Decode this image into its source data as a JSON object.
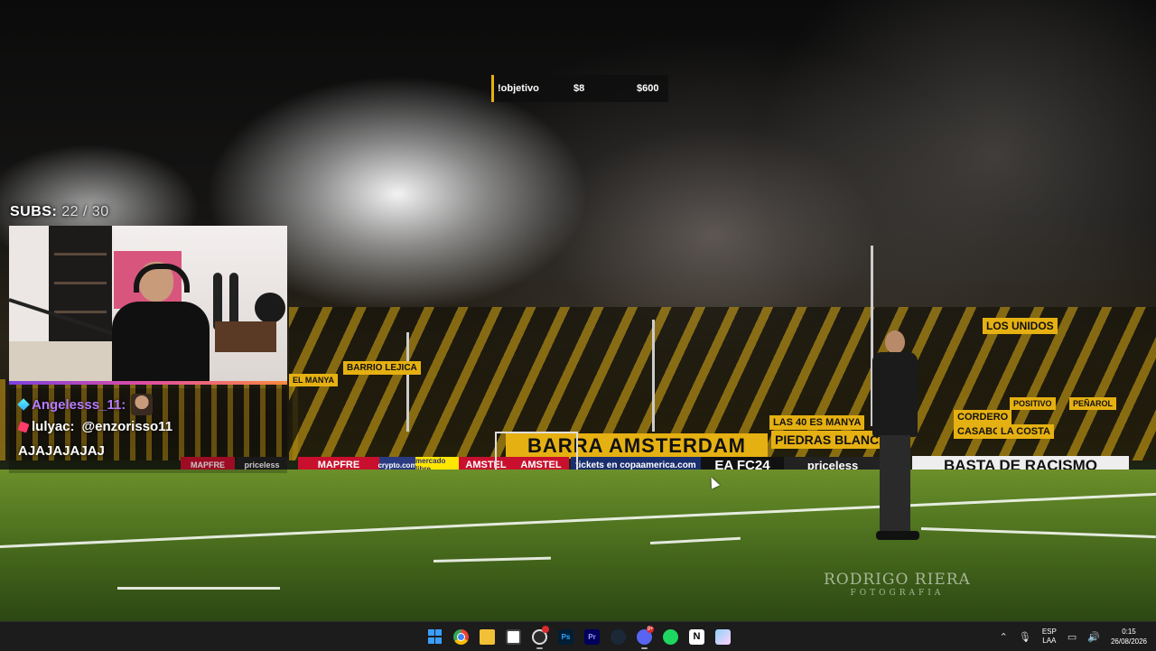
{
  "overlay": {
    "goal": {
      "label": "!objetivo",
      "current": "$8",
      "target": "$600"
    },
    "subs": {
      "label": "SUBS:",
      "count": "22 / 30"
    },
    "chat": [
      {
        "user": "Angelesss_11:",
        "message": ""
      },
      {
        "user": "lulyac:",
        "message": "@enzorisso11"
      },
      {
        "user": "",
        "message": "AJAJAJAJAJ"
      }
    ]
  },
  "wallpaper": {
    "banner": "BARRA AMSTERDAM",
    "ads": [
      "AMSTEL",
      "AMSTEL",
      "tickets en copaamerica.com",
      "EA FC24",
      "priceless",
      "BASTA DE RACISMO",
      "MAPFRE",
      "MAPFRE",
      "priceless",
      "crypto.com",
      "mercado libre"
    ],
    "signs": [
      "LAS 40 ES MANYA",
      "PIEDRAS BLANCAS",
      "CORDERO",
      "CASABO",
      "LA COSTA",
      "PEÑAROL",
      "BARRIO",
      "POSITIVO",
      "LOS UNIDOS",
      "BARRIO LEJICA",
      "EL MANYA"
    ],
    "watermark": {
      "name": "RODRIGO RIERA",
      "sub": "FOTOGRAFIA"
    }
  },
  "taskbar": {
    "apps": [
      {
        "name": "start",
        "label": ""
      },
      {
        "name": "chrome",
        "label": ""
      },
      {
        "name": "file-explorer",
        "label": ""
      },
      {
        "name": "snipping-tool",
        "label": ""
      },
      {
        "name": "obs",
        "label": ""
      },
      {
        "name": "photoshop",
        "label": "Ps"
      },
      {
        "name": "premiere",
        "label": "Pr"
      },
      {
        "name": "steam",
        "label": ""
      },
      {
        "name": "discord",
        "label": ""
      },
      {
        "name": "spotify",
        "label": ""
      },
      {
        "name": "notion",
        "label": "N"
      },
      {
        "name": "photos",
        "label": ""
      }
    ],
    "discord_badge": "9+",
    "language": {
      "line1": "ESP",
      "line2": "LAA"
    },
    "time": "0:15",
    "date": "26/08/2026"
  },
  "colors": {
    "accent": "#e5b012",
    "chat_user1": "#b77cff",
    "taskbar": "#1c1c1c"
  }
}
